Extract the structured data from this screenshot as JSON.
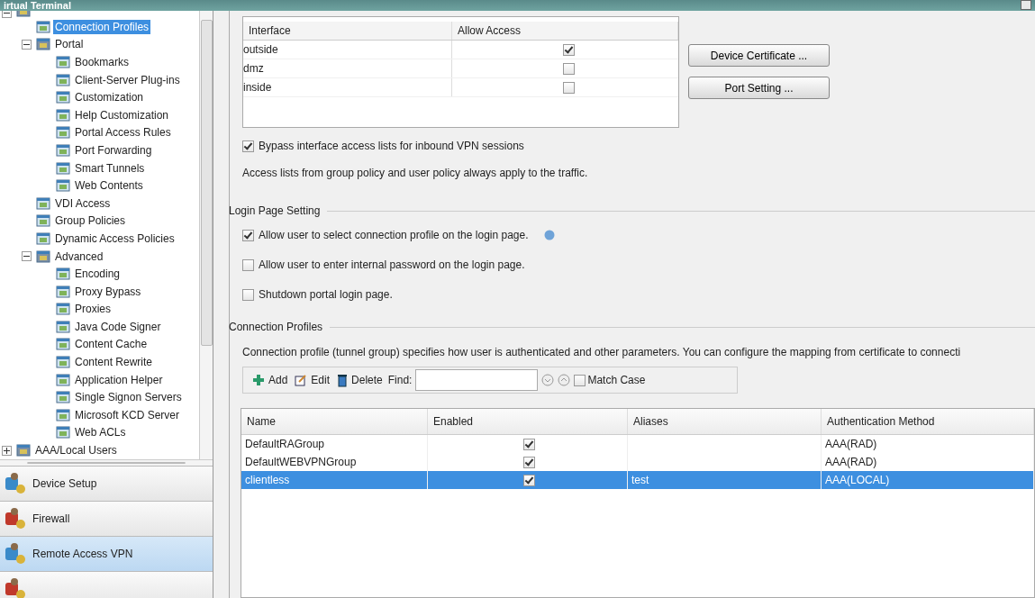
{
  "window": {
    "title": "irtual Terminal"
  },
  "tree": {
    "items": [
      {
        "expanded": true,
        "children": [
          {
            "label": "Connection Profiles",
            "selected": true
          },
          {
            "label": "Portal",
            "selected": false,
            "expanded": true,
            "children": [
              {
                "label": "Bookmarks",
                "selected": false
              },
              {
                "label": "Client-Server Plug-ins",
                "selected": false
              },
              {
                "label": "Customization",
                "selected": false
              },
              {
                "label": "Help Customization",
                "selected": false
              },
              {
                "label": "Portal Access Rules",
                "selected": false
              },
              {
                "label": "Port Forwarding",
                "selected": false
              },
              {
                "label": "Smart Tunnels",
                "selected": false
              },
              {
                "label": "Web Contents",
                "selected": false
              }
            ]
          },
          {
            "label": "VDI Access",
            "selected": false
          },
          {
            "label": "Group Policies",
            "selected": false
          },
          {
            "label": "Dynamic Access Policies",
            "selected": false
          },
          {
            "label": "Advanced",
            "selected": false,
            "expanded": true,
            "children": [
              {
                "label": "Encoding",
                "selected": false
              },
              {
                "label": "Proxy Bypass",
                "selected": false
              },
              {
                "label": "Proxies",
                "selected": false
              },
              {
                "label": "Java Code Signer",
                "selected": false
              },
              {
                "label": "Content Cache",
                "selected": false
              },
              {
                "label": "Content Rewrite",
                "selected": false
              },
              {
                "label": "Application Helper",
                "selected": false
              },
              {
                "label": "Single Signon Servers",
                "selected": false
              },
              {
                "label": "Microsoft KCD Server",
                "selected": false
              },
              {
                "label": "Web ACLs",
                "selected": false
              }
            ]
          }
        ]
      },
      {
        "label": "AAA/Local Users",
        "selected": false,
        "expanded": false
      }
    ]
  },
  "nav": [
    {
      "label": "Device Setup",
      "selected": false
    },
    {
      "label": "Firewall",
      "selected": false
    },
    {
      "label": "Remote Access VPN",
      "selected": true
    },
    {
      "selected": false
    }
  ],
  "interface_table": {
    "columns": [
      "Interface",
      "Allow Access"
    ],
    "rows": [
      {
        "interface": "outside",
        "allow_access": true
      },
      {
        "interface": "dmz",
        "allow_access": false
      },
      {
        "interface": "inside",
        "allow_access": false
      }
    ]
  },
  "buttons": [
    "Device Certificate ...",
    "Port Setting ..."
  ],
  "bypass": {
    "label": "Bypass interface access lists for inbound VPN sessions",
    "checked": true
  },
  "bypass_note": "Access lists from group policy and user policy always apply to the traffic.",
  "login_page_setting": {
    "title": "Login Page Setting",
    "options": [
      {
        "label": "Allow user to select connection profile on the login page.",
        "checked": true,
        "help": true
      },
      {
        "label": "Allow user to enter internal password on the login page.",
        "checked": false
      },
      {
        "label": "Shutdown portal login page.",
        "checked": false
      }
    ]
  },
  "connection_profiles": {
    "title": "Connection Profiles",
    "description": "Connection profile (tunnel group) specifies how user is authenticated and other parameters. You can configure the mapping from certificate to connecti",
    "toolbar": {
      "buttons": [
        "Add",
        "Edit",
        "Delete"
      ],
      "find_label": "Find:",
      "match_case": {
        "label": "Match Case",
        "checked": false
      }
    },
    "columns": [
      "Name",
      "Enabled",
      "Aliases",
      "Authentication Method"
    ],
    "rows": [
      {
        "name": "DefaultRAGroup",
        "enabled": true,
        "auth": "AAA(RAD)",
        "selected": false
      },
      {
        "name": "DefaultWEBVPNGroup",
        "enabled": true,
        "auth": "AAA(RAD)",
        "selected": false
      },
      {
        "name": "clientless",
        "enabled": true,
        "aliases": "test",
        "auth": "AAA(LOCAL)",
        "selected": true
      }
    ]
  }
}
